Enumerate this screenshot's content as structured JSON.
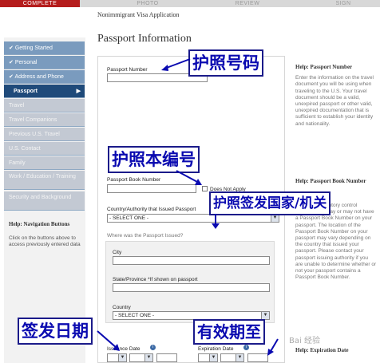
{
  "steps": {
    "complete": "COMPLETE",
    "photo": "PHOTO",
    "review": "REVIEW",
    "sign": "SIGN"
  },
  "breadcrumb": "Nonimmigrant Visa Application",
  "title": "Passport Information",
  "sidebar": {
    "items": [
      {
        "label": "Getting Started",
        "state": "done"
      },
      {
        "label": "Personal",
        "state": "done"
      },
      {
        "label": "Address and Phone",
        "state": "done"
      },
      {
        "label": "Passport",
        "state": "active"
      },
      {
        "label": "Travel",
        "state": "todo"
      },
      {
        "label": "Travel Companions",
        "state": "todo"
      },
      {
        "label": "Previous U.S. Travel",
        "state": "todo"
      },
      {
        "label": "U.S. Contact",
        "state": "todo"
      },
      {
        "label": "Family",
        "state": "todo"
      },
      {
        "label": "Work / Education / Training",
        "state": "todo"
      },
      {
        "label": "Security and Background",
        "state": "todo"
      }
    ],
    "check_icon": "check-icon",
    "chevron_icon": "chevron-right-icon"
  },
  "nav_help": {
    "title": "Help: Navigation Buttons",
    "text": "Click on the buttons above to access previously entered data"
  },
  "form": {
    "passport_number_label": "Passport Number",
    "passport_book_label": "Passport Book Number",
    "does_not_apply": "Does Not Apply",
    "country_authority_label": "Country/Authority that Issued Passport",
    "country_authority_value": "- SELECT ONE -",
    "issued_where_label": "Where was the Passport Issued?",
    "city_label": "City",
    "state_label": "State/Province *If shown on passport",
    "country_label": "Country",
    "country_value": "- SELECT ONE -",
    "issuance_date_label": "Issuance Date",
    "expiration_date_label": "Expiration Date"
  },
  "help_passport_number": {
    "title": "Help: Passport Number",
    "text": "Enter the information on the travel document you will be using when traveling to the U.S. Your travel document should be a valid, unexpired passport or other valid, unexpired documentation that is sufficient to establish your identity and nationality."
  },
  "help_passport_book": {
    "title": "Help: Passport Book Number",
    "text": "called the inventory control number. You may or may not have a Passport Book Number on your passport. The location of the Passport Book Number on your passport may vary depending on the country that issued your passport. Please contact your passport issuing authority if you are unable to determine whether or not your passport contains a Passport Book Number."
  },
  "help_expiration": {
    "title": "Help: Expiration Date"
  },
  "annotations": {
    "passport_number": "护照号码",
    "passport_book": "护照本编号",
    "issuing_authority": "护照签发国家/机关",
    "issuance_date": "签发日期",
    "expiration_date": "有效期至"
  },
  "watermark": "Bai 经验"
}
